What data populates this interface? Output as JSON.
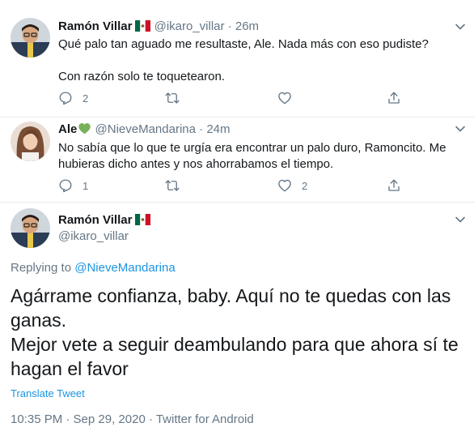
{
  "tweets": [
    {
      "name": "Ramón Villar",
      "handle": "@ikaro_villar",
      "time": "26m",
      "text": "Qué palo tan aguado me resultaste, Ale. Nada más con eso pudiste?\n\nCon razón solo te toquetearon.",
      "reply_count": "2",
      "retweet_count": "",
      "like_count": ""
    },
    {
      "name": "Ale",
      "handle": "@NieveMandarina",
      "time": "24m",
      "text": "No sabía que lo que te urgía era encontrar un palo duro, Ramoncito. Me hubieras dicho antes y nos ahorrabamos el tiempo.",
      "reply_count": "1",
      "retweet_count": "",
      "like_count": "2"
    }
  ],
  "focused": {
    "name": "Ramón Villar",
    "handle": "@ikaro_villar",
    "replying_prefix": "Replying to",
    "replying_to": "@NieveMandarina",
    "text": "Agárrame confianza, baby. Aquí no te quedas con las ganas.\nMejor vete a seguir deambulando para que ahora sí te hagan el favor",
    "translate_label": "Translate Tweet",
    "meta": "10:35 PM · Sep 29, 2020 · Twitter for Android"
  },
  "separator": "·",
  "icons": {
    "reply": "reply-icon",
    "retweet": "retweet-icon",
    "like": "heart-icon",
    "share": "share-icon",
    "more": "chevron-down-icon",
    "flag": "mexico-flag-icon",
    "green_heart": "green-heart-emoji-icon"
  },
  "colors": {
    "accent": "#1b95e0",
    "secondary_text": "#657786",
    "primary_text": "#14171a",
    "divider": "#e6ecf0"
  }
}
